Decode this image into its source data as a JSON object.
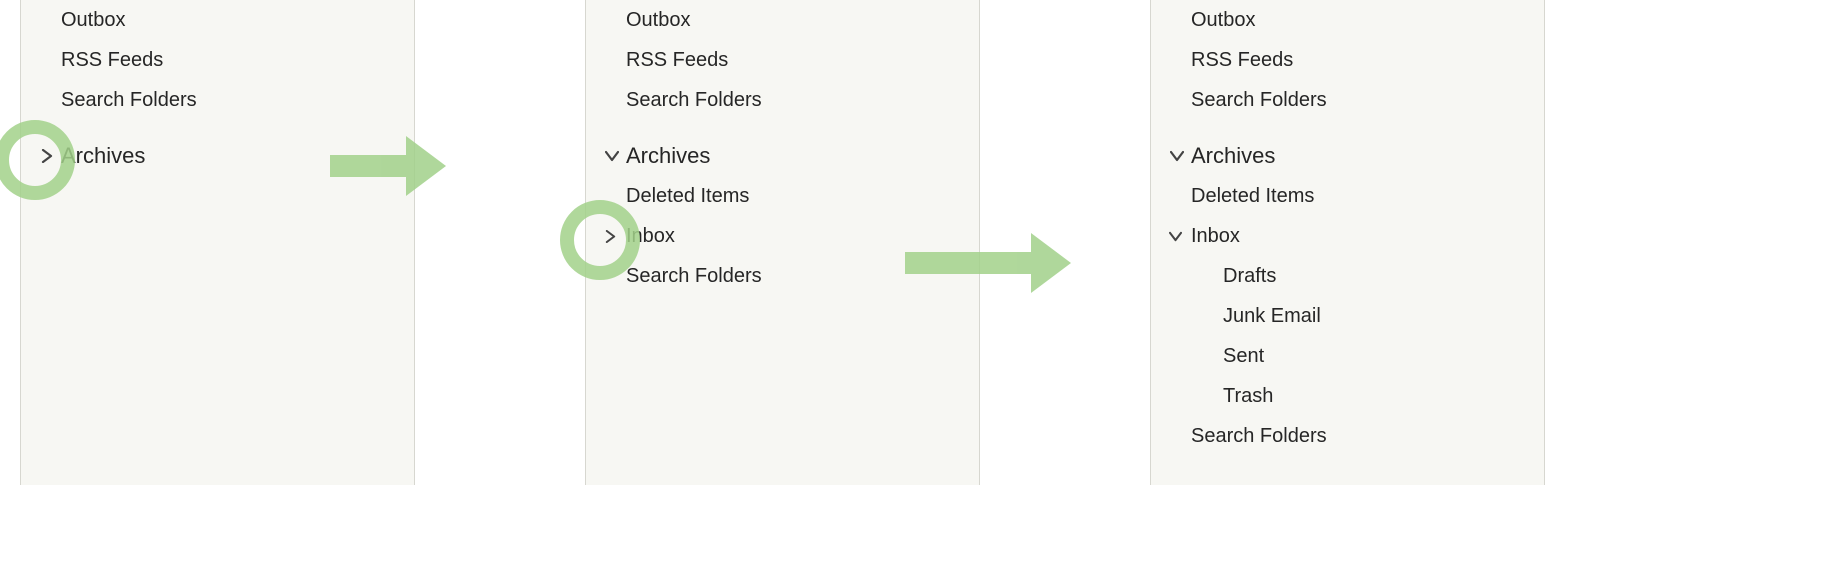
{
  "annotation_color": "#a2d18a",
  "panels": [
    {
      "id": "panel-1",
      "items": [
        {
          "label": "Outbox",
          "indent": 1,
          "expand": null,
          "name": "folder-outbox"
        },
        {
          "label": "RSS Feeds",
          "indent": 1,
          "expand": null,
          "name": "folder-rss-feeds"
        },
        {
          "label": "Search Folders",
          "indent": 1,
          "expand": null,
          "name": "folder-search-folders"
        },
        {
          "gap": true
        },
        {
          "label": "Archives",
          "indent": 0,
          "expand": "collapsed",
          "group": true,
          "name": "group-archives"
        }
      ]
    },
    {
      "id": "panel-2",
      "items": [
        {
          "label": "Outbox",
          "indent": 1,
          "expand": null,
          "name": "folder-outbox"
        },
        {
          "label": "RSS Feeds",
          "indent": 1,
          "expand": null,
          "name": "folder-rss-feeds"
        },
        {
          "label": "Search Folders",
          "indent": 1,
          "expand": null,
          "name": "folder-search-folders"
        },
        {
          "gap": true
        },
        {
          "label": "Archives",
          "indent": 0,
          "expand": "expanded",
          "group": true,
          "name": "group-archives"
        },
        {
          "label": "Deleted Items",
          "indent": 1,
          "expand": null,
          "name": "folder-deleted-items"
        },
        {
          "label": "Inbox",
          "indent": 1,
          "expand": "collapsed",
          "name": "folder-inbox"
        },
        {
          "label": "Search Folders",
          "indent": 1,
          "expand": null,
          "name": "folder-search-folders-archive"
        }
      ]
    },
    {
      "id": "panel-3",
      "items": [
        {
          "label": "Outbox",
          "indent": 1,
          "expand": null,
          "name": "folder-outbox"
        },
        {
          "label": "RSS Feeds",
          "indent": 1,
          "expand": null,
          "name": "folder-rss-feeds"
        },
        {
          "label": "Search Folders",
          "indent": 1,
          "expand": null,
          "name": "folder-search-folders"
        },
        {
          "gap": true
        },
        {
          "label": "Archives",
          "indent": 0,
          "expand": "expanded",
          "group": true,
          "name": "group-archives"
        },
        {
          "label": "Deleted Items",
          "indent": 1,
          "expand": null,
          "name": "folder-deleted-items"
        },
        {
          "label": "Inbox",
          "indent": 1,
          "expand": "expanded",
          "name": "folder-inbox"
        },
        {
          "label": "Drafts",
          "indent": 2,
          "expand": null,
          "name": "folder-drafts"
        },
        {
          "label": "Junk Email",
          "indent": 2,
          "expand": null,
          "name": "folder-junk-email"
        },
        {
          "label": "Sent",
          "indent": 2,
          "expand": null,
          "name": "folder-sent"
        },
        {
          "label": "Trash",
          "indent": 2,
          "expand": null,
          "name": "folder-trash"
        },
        {
          "label": "Search Folders",
          "indent": 1,
          "expand": null,
          "name": "folder-search-folders-archive"
        }
      ]
    }
  ]
}
